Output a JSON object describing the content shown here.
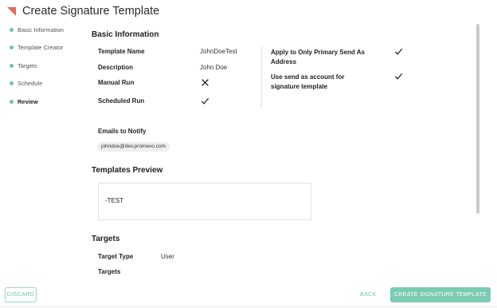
{
  "header": {
    "title": "Create Signature Template"
  },
  "colors": {
    "accent": "#6cc4a9",
    "logo": "#e8675d"
  },
  "steps": [
    {
      "label": "Basic Information",
      "active": false
    },
    {
      "label": "Template Creator",
      "active": false
    },
    {
      "label": "Targets",
      "active": false
    },
    {
      "label": "Schedule",
      "active": false
    },
    {
      "label": "Review",
      "active": true
    }
  ],
  "basic_info": {
    "heading": "Basic Information",
    "template_name_label": "Template Name",
    "template_name_value": "JohnDoeTest",
    "description_label": "Description",
    "description_value": "John Doe",
    "manual_run_label": "Manual Run",
    "manual_run_icon": "x-icon",
    "scheduled_run_label": "Scheduled Run",
    "scheduled_run_icon": "check-icon",
    "primary_send_as_label": "Apply to Only Primary Send As Address",
    "primary_send_as_icon": "check-icon",
    "send_as_account_label": "Use send as account for signature template",
    "send_as_account_icon": "check-icon",
    "emails_label": "Emails to Notify",
    "emails": [
      "johndoe@dev.promevo.com"
    ]
  },
  "preview": {
    "heading": "Templates Preview",
    "text": "-TEST"
  },
  "targets": {
    "heading": "Targets",
    "target_type_label": "Target Type",
    "target_type_value": "User",
    "targets_label": "Targets"
  },
  "footer": {
    "discard": "DISCARD",
    "back": "BACK",
    "create": "CREATE SIGNATURE TEMPLATE"
  }
}
